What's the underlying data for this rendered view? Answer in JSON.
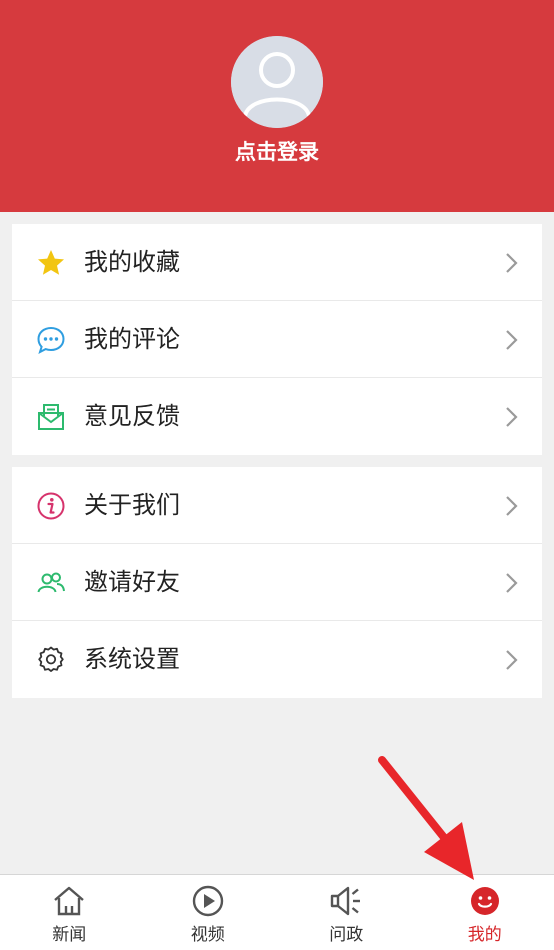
{
  "header": {
    "login_label": "点击登录"
  },
  "menu_group_1": [
    {
      "label": "我的收藏",
      "icon": "star-icon"
    },
    {
      "label": "我的评论",
      "icon": "comment-icon"
    },
    {
      "label": "意见反馈",
      "icon": "feedback-icon"
    }
  ],
  "menu_group_2": [
    {
      "label": "关于我们",
      "icon": "info-icon"
    },
    {
      "label": "邀请好友",
      "icon": "friends-icon"
    },
    {
      "label": "系统设置",
      "icon": "settings-icon"
    }
  ],
  "tabs": [
    {
      "label": "新闻",
      "icon": "home-icon"
    },
    {
      "label": "视频",
      "icon": "play-icon"
    },
    {
      "label": "问政",
      "icon": "megaphone-icon"
    },
    {
      "label": "我的",
      "icon": "smiley-icon",
      "active": true
    }
  ],
  "colors": {
    "brand": "#d63a3e",
    "active_tab": "#d6262a",
    "annotation_arrow": "#e8262a"
  }
}
